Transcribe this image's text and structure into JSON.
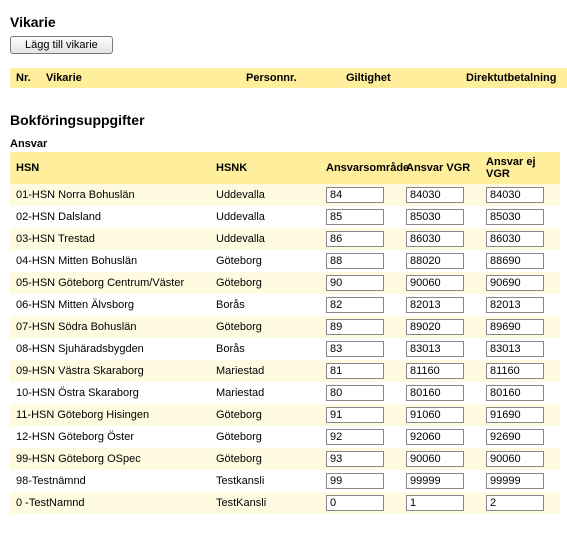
{
  "vikarie": {
    "title": "Vikarie",
    "add_button": "Lägg till vikarie",
    "headers": {
      "nr": "Nr.",
      "vikarie": "Vikarie",
      "personnr": "Personnr.",
      "giltighet": "Giltighet",
      "direkt": "Direktutbetalning"
    }
  },
  "bokforing": {
    "title": "Bokföringsuppgifter",
    "ansvar_label": "Ansvar",
    "headers": {
      "hsn": "HSN",
      "hsnk": "HSNK",
      "ansvarsomrade": "Ansvarsområde",
      "ansvar_vgr": "Ansvar VGR",
      "ansvar_ej_vgr": "Ansvar ej VGR"
    },
    "rows": [
      {
        "hsn": "01-HSN Norra Bohuslän",
        "hsnk": "Uddevalla",
        "a": "84",
        "b": "84030",
        "c": "84030"
      },
      {
        "hsn": "02-HSN Dalsland",
        "hsnk": "Uddevalla",
        "a": "85",
        "b": "85030",
        "c": "85030"
      },
      {
        "hsn": "03-HSN Trestad",
        "hsnk": "Uddevalla",
        "a": "86",
        "b": "86030",
        "c": "86030"
      },
      {
        "hsn": "04-HSN Mitten Bohuslän",
        "hsnk": "Göteborg",
        "a": "88",
        "b": "88020",
        "c": "88690"
      },
      {
        "hsn": "05-HSN Göteborg Centrum/Väster",
        "hsnk": "Göteborg",
        "a": "90",
        "b": "90060",
        "c": "90690"
      },
      {
        "hsn": "06-HSN Mitten Älvsborg",
        "hsnk": "Borås",
        "a": "82",
        "b": "82013",
        "c": "82013"
      },
      {
        "hsn": "07-HSN Södra Bohuslän",
        "hsnk": "Göteborg",
        "a": "89",
        "b": "89020",
        "c": "89690"
      },
      {
        "hsn": "08-HSN Sjuhäradsbygden",
        "hsnk": "Borås",
        "a": "83",
        "b": "83013",
        "c": "83013"
      },
      {
        "hsn": "09-HSN Västra Skaraborg",
        "hsnk": "Mariestad",
        "a": "81",
        "b": "81160",
        "c": "81160"
      },
      {
        "hsn": "10-HSN Östra Skaraborg",
        "hsnk": "Mariestad",
        "a": "80",
        "b": "80160",
        "c": "80160"
      },
      {
        "hsn": "11-HSN Göteborg Hisingen",
        "hsnk": "Göteborg",
        "a": "91",
        "b": "91060",
        "c": "91690"
      },
      {
        "hsn": "12-HSN Göteborg Öster",
        "hsnk": "Göteborg",
        "a": "92",
        "b": "92060",
        "c": "92690"
      },
      {
        "hsn": "99-HSN Göteborg OSpec",
        "hsnk": "Göteborg",
        "a": "93",
        "b": "90060",
        "c": "90060"
      },
      {
        "hsn": "98-Testnämnd",
        "hsnk": "Testkansli",
        "a": "99",
        "b": "99999",
        "c": "99999"
      },
      {
        "hsn": "0 -TestNamnd",
        "hsnk": "TestKansli",
        "a": "0",
        "b": "1",
        "c": "2"
      }
    ]
  }
}
